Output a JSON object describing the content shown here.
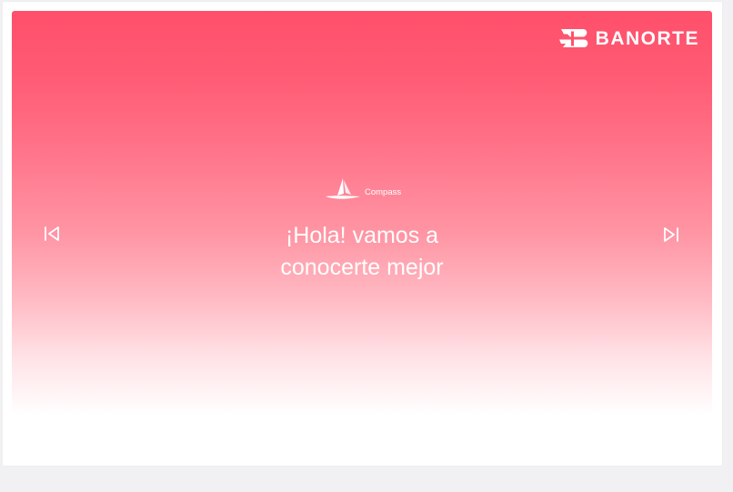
{
  "header": {
    "logo_text": "BANORTE",
    "logo_icon": "banorte-logo-icon"
  },
  "brand": {
    "name": "Compass",
    "icon": "compass-sail-logo-icon"
  },
  "hero": {
    "headline_line1": "¡Hola! vamos a",
    "headline_line2": "conocerte mejor"
  },
  "navigation": {
    "previous_icon": "skip-previous-icon",
    "next_icon": "skip-next-icon"
  },
  "colors": {
    "hero_top": "#ff4f6b",
    "hero_bottom": "#ffffff",
    "text": "#ffffff",
    "page_background": "#f1f1f3"
  }
}
